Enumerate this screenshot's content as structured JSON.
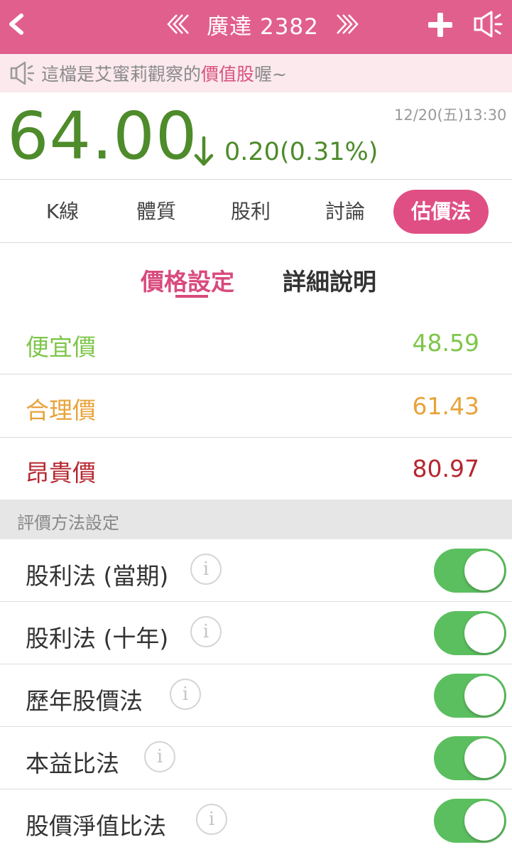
{
  "header": {
    "title": "廣達 2382",
    "back_icon": "chevron-left-icon",
    "prev_icon": "double-chevron-left-icon",
    "next_icon": "double-chevron-right-icon",
    "add_icon": "plus-icon",
    "speaker_icon": "megaphone-icon",
    "background_color": "#e15f8c"
  },
  "notice": {
    "prefix": "這檔是艾蜜莉觀察的",
    "highlight": "價值股",
    "suffix": "喔~"
  },
  "quote": {
    "price": "64.00",
    "change": "0.20(0.31%)",
    "direction": "down",
    "timestamp": "12/20(五)13:30",
    "color": "#4e8b2b"
  },
  "tabs": [
    {
      "label": "K線",
      "active": false
    },
    {
      "label": "體質",
      "active": false
    },
    {
      "label": "股利",
      "active": false
    },
    {
      "label": "討論",
      "active": false
    },
    {
      "label": "估價法",
      "active": true
    }
  ],
  "subtabs": [
    {
      "label": "價格設定",
      "active": true
    },
    {
      "label": "詳細說明",
      "active": false
    }
  ],
  "prices": [
    {
      "label": "便宜價",
      "value": "48.59",
      "color": "#7ec64a"
    },
    {
      "label": "合理價",
      "value": "61.43",
      "color": "#e8a33a"
    },
    {
      "label": "昂貴價",
      "value": "80.97",
      "color": "#b5262e"
    }
  ],
  "methods_section_title": "評價方法設定",
  "methods": [
    {
      "label": "股利法 (當期)",
      "enabled": true
    },
    {
      "label": "股利法 (十年)",
      "enabled": true
    },
    {
      "label": "歷年股價法",
      "enabled": true
    },
    {
      "label": "本益比法",
      "enabled": true
    },
    {
      "label": "股價淨值比法",
      "enabled": true
    }
  ],
  "info_glyph": "i",
  "toggle_on_color": "#5cbf5f"
}
